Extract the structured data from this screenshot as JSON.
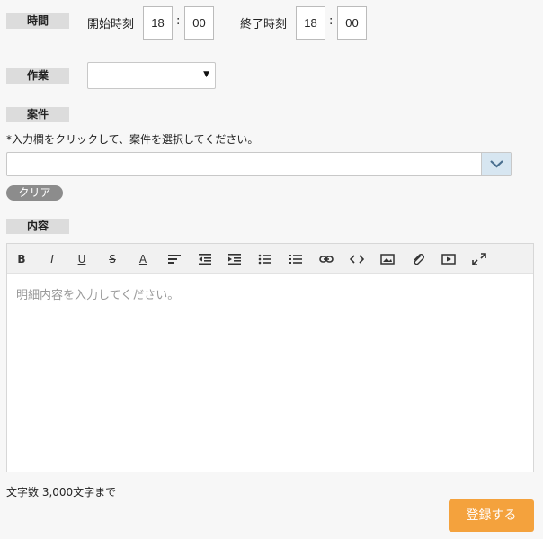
{
  "time": {
    "label": "時間",
    "start_label": "開始時刻",
    "start_hour": "18",
    "start_minute": "00",
    "end_label": "終了時刻",
    "end_hour": "18",
    "end_minute": "00",
    "separator": ":"
  },
  "work": {
    "label": "作業",
    "selected": "",
    "arrow": "▼"
  },
  "project": {
    "label": "案件",
    "instruction": "*入力欄をクリックして、案件を選択してください。",
    "value": "",
    "clear_label": "クリア"
  },
  "content": {
    "label": "内容",
    "toolbar": {
      "bold": "B",
      "italic": "I",
      "underline": "U",
      "strike": "S",
      "font_color": "A"
    },
    "placeholder": "明細内容を入力してください。",
    "counter": "文字数 3,000文字まで"
  },
  "submit": {
    "label": "登録する",
    "color": "#f4a23d"
  }
}
